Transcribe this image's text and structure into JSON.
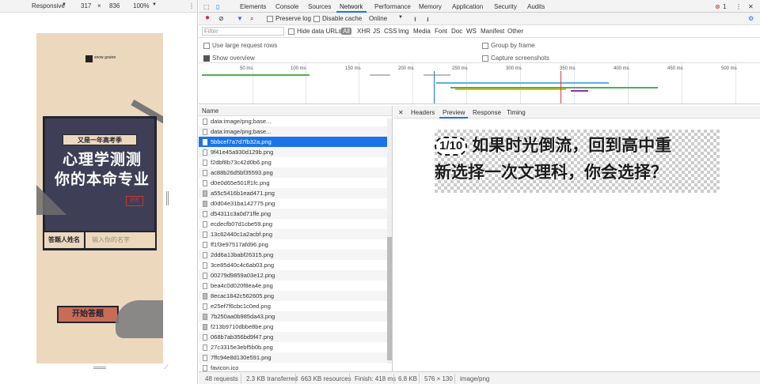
{
  "emulation": {
    "device": "Responsive",
    "width": "317",
    "x": "×",
    "height": "836",
    "zoom": "100%"
  },
  "phone": {
    "logo_text": "snow goutre",
    "headline_small": "又是一年高考季",
    "headline_big_1": "心理学测测",
    "headline_big_2": "你的本命专业",
    "stamp": "绝密",
    "name_label": "答题人姓名",
    "name_placeholder": "输入你的名字",
    "start_button": "开始答题"
  },
  "devtools": {
    "tabs": [
      "Elements",
      "Console",
      "Sources",
      "Network",
      "Performance",
      "Memory",
      "Application",
      "Security",
      "Audits"
    ],
    "active_tab": "Network",
    "error_count": "1",
    "toolbar": {
      "preserve_log": "Preserve log",
      "disable_cache": "Disable cache",
      "throttle": "Online"
    },
    "filter": {
      "placeholder": "Filter",
      "hide_data_urls": "Hide data URLs",
      "types": [
        "All",
        "XHR",
        "JS",
        "CSS",
        "Img",
        "Media",
        "Font",
        "Doc",
        "WS",
        "Manifest",
        "Other"
      ]
    },
    "options": {
      "large_rows": "Use large request rows",
      "overview": "Show overview",
      "group_by_frame": "Group by frame",
      "capture_screenshots": "Capture screenshots"
    },
    "timeline_ticks": [
      "50 ms",
      "100 ms",
      "150 ms",
      "200 ms",
      "250 ms",
      "300 ms",
      "350 ms",
      "400 ms",
      "450 ms",
      "500 ms"
    ],
    "list_header": "Name",
    "requests": [
      "data:image/png;base...",
      "data:image/png;base...",
      "5bbcef7a7d7fb32a.png",
      "9f41e45a930d129b.png",
      "f2dbf8b73c42d0b6.png",
      "ac88b26d5bf35593.png",
      "d0e0d65e501ff1fc.png",
      "a55c5416b1ead471.png",
      "d0d04e31ba142775.png",
      "d54311c3a0d71ffe.png",
      "ecdecfb07d1cbe59.png",
      "13c62440c1a2acbf.png",
      "ff1f3e97517afd96.png",
      "2dd6a13babf26315.png",
      "3ce85d40c4c6ab03.png",
      "00279d9859a03e12.png",
      "bea4c0d020f8ea4e.png",
      "8ecac1842c562605.png",
      "e25ef7f6cbc1c0ed.png",
      "7b250aa0b985da43.png",
      "f213b9710dbbe8be.png",
      "068b7ab356bd9f47.png",
      "27c3315e3ebf5b0b.png",
      "7ffc94e8d130e591.png",
      "favicon.ico"
    ],
    "selected_request": "5bbcef7a7d7fb32a.png",
    "preview_tabs": [
      "Headers",
      "Preview",
      "Response",
      "Timing"
    ],
    "active_preview_tab": "Preview",
    "preview": {
      "number": "1/10",
      "line1": "如果时光倒流，回到高中重",
      "line2": "新选择一次文理科，你会选择？"
    },
    "status": {
      "requests": "48 requests",
      "transferred": "2.3 KB transferred",
      "resources": "663 KB resources",
      "finish": "Finish: 418 ms",
      "size": "6.8 KB",
      "dimensions": "576 × 130",
      "mime": "image/png"
    }
  },
  "colors": {
    "accent": "#1a73e8",
    "phone_bg": "#ecd8bd",
    "board": "#3e3f56",
    "button": "#c96b55"
  }
}
